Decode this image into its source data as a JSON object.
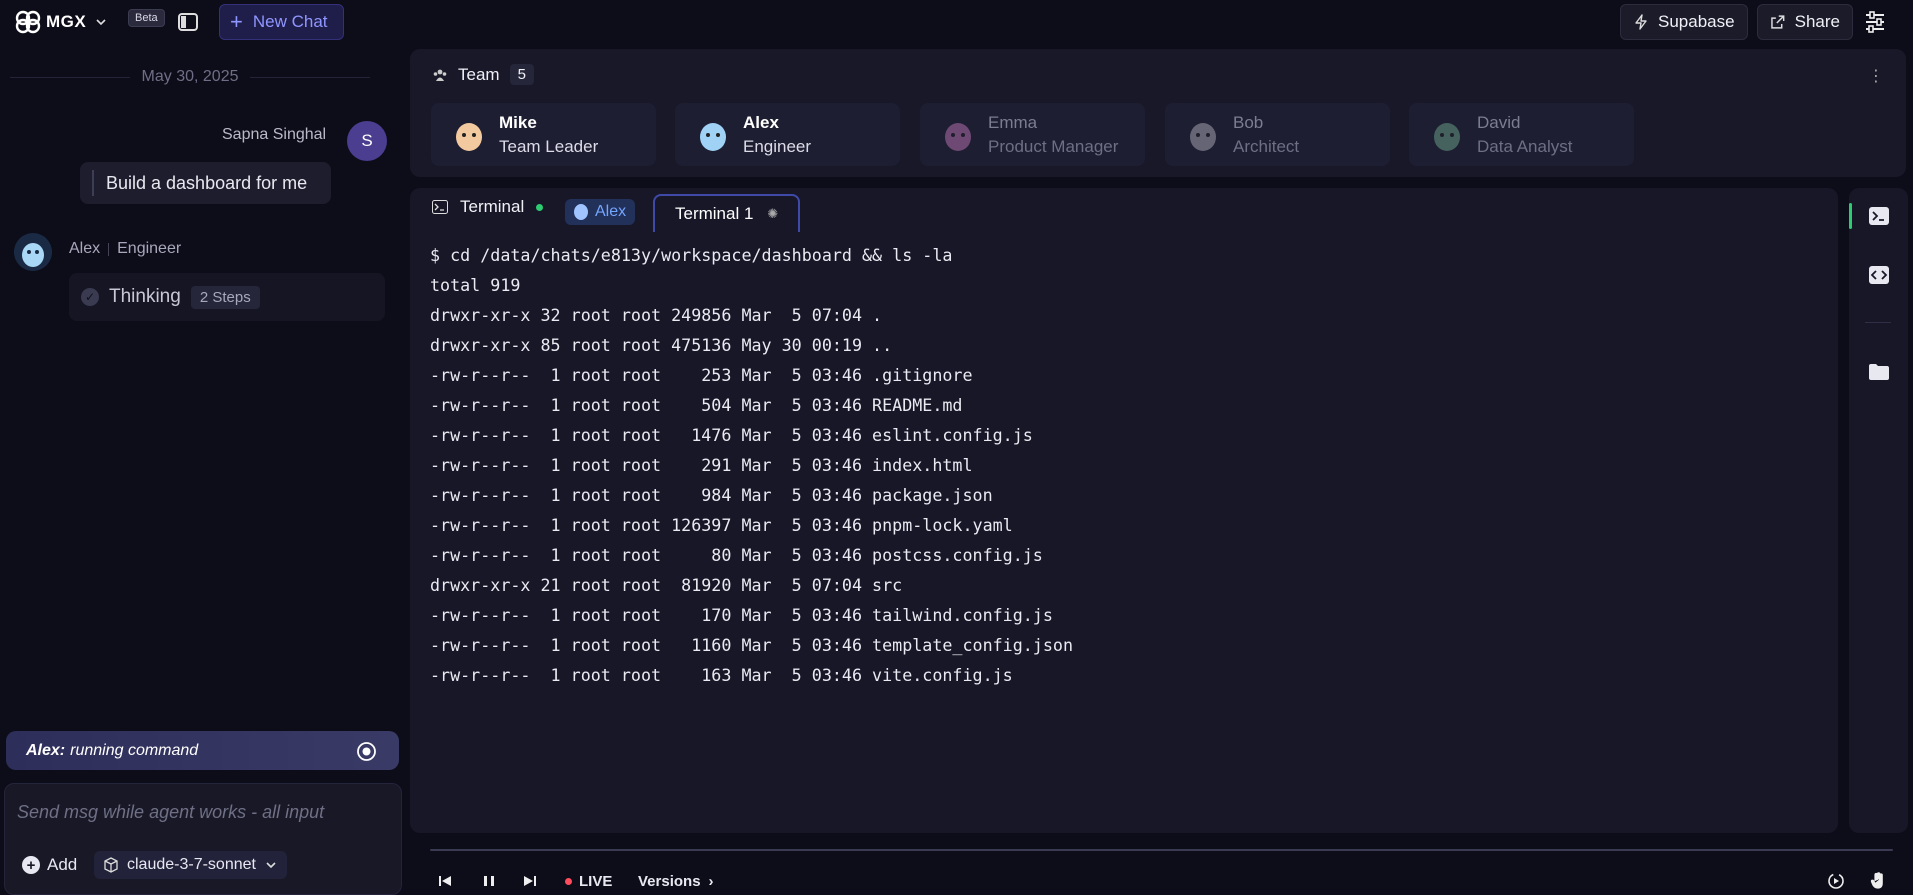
{
  "header": {
    "brand": "MGX",
    "beta_badge": "Beta",
    "new_chat_label": "New Chat",
    "supabase_label": "Supabase",
    "share_label": "Share"
  },
  "chat": {
    "date": "May 30, 2025",
    "user": {
      "name": "Sapna Singhal",
      "initial": "S",
      "message": "Build a dashboard for me"
    },
    "agent": {
      "name": "Alex",
      "role": "Engineer",
      "thinking_label": "Thinking",
      "steps_label": "2 Steps"
    },
    "status": {
      "agent": "Alex:",
      "text": "running command"
    },
    "composer": {
      "placeholder": "Send msg while agent works - all input",
      "add_label": "Add",
      "model_label": "claude-3-7-sonnet"
    }
  },
  "team": {
    "label": "Team",
    "count": "5",
    "members": [
      {
        "name": "Mike",
        "role": "Team Leader",
        "active": true,
        "color": "#f3c9a0"
      },
      {
        "name": "Alex",
        "role": "Engineer",
        "active": true,
        "color": "#9fd2f5"
      },
      {
        "name": "Emma",
        "role": "Product Manager",
        "active": false,
        "color": "#e58ad6"
      },
      {
        "name": "Bob",
        "role": "Architect",
        "active": false,
        "color": "#cfcfd8"
      },
      {
        "name": "David",
        "role": "Data Analyst",
        "active": false,
        "color": "#7fc9a0"
      }
    ]
  },
  "terminal": {
    "label": "Terminal",
    "agent_chip": "Alex",
    "tab_label": "Terminal 1",
    "lines": [
      "$ cd /data/chats/e813y/workspace/dashboard && ls -la",
      "total 919",
      "drwxr-xr-x 32 root root 249856 Mar  5 07:04 .",
      "drwxr-xr-x 85 root root 475136 May 30 00:19 ..",
      "-rw-r--r--  1 root root    253 Mar  5 03:46 .gitignore",
      "-rw-r--r--  1 root root    504 Mar  5 03:46 README.md",
      "-rw-r--r--  1 root root   1476 Mar  5 03:46 eslint.config.js",
      "-rw-r--r--  1 root root    291 Mar  5 03:46 index.html",
      "-rw-r--r--  1 root root    984 Mar  5 03:46 package.json",
      "-rw-r--r--  1 root root 126397 Mar  5 03:46 pnpm-lock.yaml",
      "-rw-r--r--  1 root root     80 Mar  5 03:46 postcss.config.js",
      "drwxr-xr-x 21 root root  81920 Mar  5 07:04 src",
      "-rw-r--r--  1 root root    170 Mar  5 03:46 tailwind.config.js",
      "-rw-r--r--  1 root root   1160 Mar  5 03:46 template_config.json",
      "-rw-r--r--  1 root root    163 Mar  5 03:46 vite.config.js"
    ]
  },
  "playback": {
    "live_label": "LIVE",
    "versions_label": "Versions"
  },
  "icons": {
    "logo": "mgx-logo-icon",
    "sidebar_toggle": "sidebar-toggle-icon",
    "rail": [
      "terminal-icon",
      "code-icon",
      "folder-icon"
    ],
    "controls": [
      "skip-back-icon",
      "pause-icon",
      "skip-forward-icon",
      "replay-icon",
      "hand-icon"
    ]
  },
  "colors": {
    "accent": "#8f96ff",
    "live": "#ff4d5e",
    "online": "#2ecc71"
  }
}
